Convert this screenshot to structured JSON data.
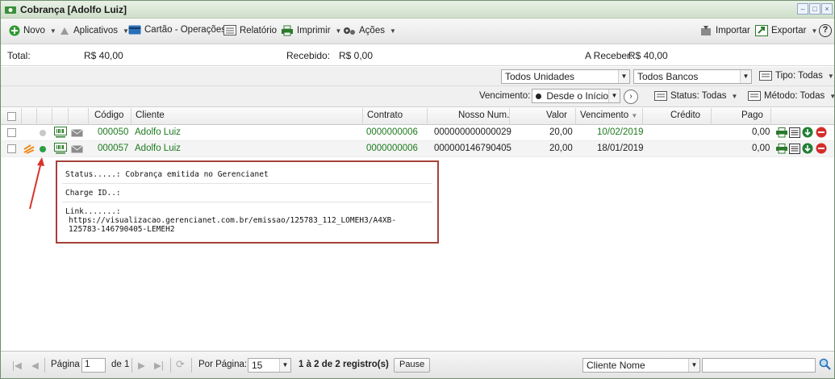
{
  "window": {
    "title": "Cobrança [Adolfo Luiz]",
    "buttons": [
      "–",
      "□",
      "×"
    ]
  },
  "toolbar": {
    "novo": "Novo",
    "aplicativos": "Aplicativos",
    "cartao": "Cartão - Operações",
    "relatorio": "Relatório",
    "imprimir": "Imprimir",
    "acoes": "Ações",
    "importar": "Importar",
    "exportar": "Exportar",
    "help": "?"
  },
  "totals": {
    "total_label": "Total:",
    "total_value": "R$ 40,00",
    "recebido_label": "Recebido:",
    "recebido_value": "R$ 0,00",
    "receber_label": "A Receber:",
    "receber_value": "R$ 40,00"
  },
  "filters": {
    "unidades": "Todos Unidades",
    "bancos": "Todos Bancos",
    "tipo": "Tipo: Todas",
    "vencimento_label": "Vencimento:",
    "vencimento_value": "Desde o Início",
    "status": "Status: Todas",
    "metodo": "Método: Todas"
  },
  "grid": {
    "headers": {
      "codigo": "Código",
      "cliente": "Cliente",
      "contrato": "Contrato",
      "nosso_num": "Nosso Num.",
      "valor": "Valor",
      "vencimento": "Vencimento",
      "credito": "Crédito",
      "pago": "Pago"
    },
    "rows": [
      {
        "codigo": "000050",
        "cliente": "Adolfo Luiz",
        "contrato": "0000000006",
        "nosso_num": "000000000000029",
        "valor": "20,00",
        "vencimento": "10/02/2019",
        "credito": "",
        "pago": "0,00",
        "status_color": "#c8c8c8"
      },
      {
        "codigo": "000057",
        "cliente": "Adolfo Luiz",
        "contrato": "0000000006",
        "nosso_num": "000000146790405",
        "valor": "20,00",
        "vencimento": "18/01/2019",
        "credito": "",
        "pago": "0,00",
        "status_color": "#2e9e4a"
      }
    ]
  },
  "popup": {
    "status": "Status.....: Cobrança emitida no Gerencianet",
    "charge_id": "Charge ID..:",
    "link_label": "Link.......:",
    "link_line1": "https://visualizacao.gerencianet.com.br/emissao/125783_112_LOMEH3/A4XB-",
    "link_line2": "125783-146790405-LEMEH2"
  },
  "pager": {
    "pagina_label": "Página",
    "page": "1",
    "de": "de 1",
    "por_pagina_label": "Por Página:",
    "por_pagina": "15",
    "registros": "1 à 2 de 2 registro(s)",
    "pause": "Pause",
    "search_field": "Cliente Nome",
    "search_value": ""
  },
  "colors": {
    "accent_green": "#1d7a1d",
    "popup_border": "#a5413a",
    "arrow": "#d9342b"
  }
}
